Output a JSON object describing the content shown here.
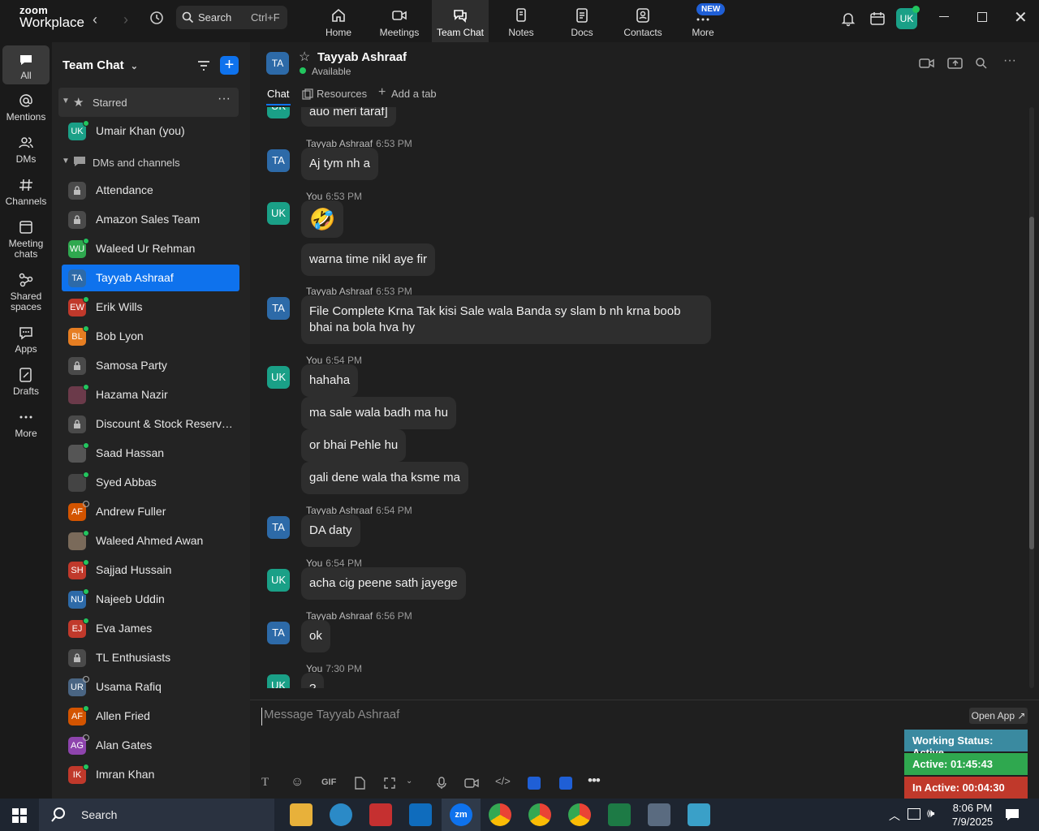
{
  "app": {
    "logo_line1": "zoom",
    "logo_line2": "Workplace"
  },
  "topbar": {
    "search_label": "Search",
    "search_shortcut": "Ctrl+F",
    "nav": [
      {
        "label": "Home"
      },
      {
        "label": "Meetings"
      },
      {
        "label": "Team Chat"
      },
      {
        "label": "Notes"
      },
      {
        "label": "Docs"
      },
      {
        "label": "Contacts"
      },
      {
        "label": "More"
      }
    ],
    "new_badge": "NEW",
    "user_initials": "UK"
  },
  "rail": [
    {
      "label": "All"
    },
    {
      "label": "Mentions"
    },
    {
      "label": "DMs"
    },
    {
      "label": "Channels"
    },
    {
      "label1": "Meeting",
      "label2": "chats"
    },
    {
      "label1": "Shared",
      "label2": "spaces"
    },
    {
      "label": "Apps"
    },
    {
      "label": "Drafts"
    },
    {
      "label": "More"
    }
  ],
  "sidebar": {
    "title": "Team Chat",
    "starred_label": "Starred",
    "dms_label": "DMs and channels",
    "self": {
      "initials": "UK",
      "name": "Umair Khan (you)"
    },
    "chats": [
      {
        "initials": "",
        "name": "Attendance"
      },
      {
        "initials": "",
        "name": "Amazon Sales Team"
      },
      {
        "initials": "WU",
        "name": "Waleed Ur Rehman"
      },
      {
        "initials": "TA",
        "name": "Tayyab Ashraaf"
      },
      {
        "initials": "EW",
        "name": "Erik Wills"
      },
      {
        "initials": "BL",
        "name": "Bob Lyon"
      },
      {
        "initials": "",
        "name": "Samosa Party"
      },
      {
        "initials": "",
        "name": "Hazama Nazir"
      },
      {
        "initials": "",
        "name": "Discount & Stock Reservati..."
      },
      {
        "initials": "",
        "name": "Saad Hassan"
      },
      {
        "initials": "",
        "name": "Syed Abbas"
      },
      {
        "initials": "AF",
        "name": "Andrew Fuller"
      },
      {
        "initials": "",
        "name": "Waleed Ahmed Awan"
      },
      {
        "initials": "SH",
        "name": "Sajjad Hussain"
      },
      {
        "initials": "NU",
        "name": "Najeeb Uddin"
      },
      {
        "initials": "EJ",
        "name": "Eva James"
      },
      {
        "initials": "",
        "name": "TL Enthusiasts"
      },
      {
        "initials": "UR",
        "name": "Usama Rafiq"
      },
      {
        "initials": "AF",
        "name": "Allen Fried"
      },
      {
        "initials": "AG",
        "name": "Alan Gates"
      },
      {
        "initials": "IK",
        "name": "Imran Khan"
      }
    ]
  },
  "main": {
    "contact_initials": "TA",
    "contact_name": "Tayyab Ashraaf",
    "contact_status": "Available",
    "tabs": {
      "chat": "Chat",
      "resources": "Resources",
      "add": "Add a tab"
    },
    "top_partial": "auo meri taraf]",
    "messages": [
      {
        "av": "TA",
        "sender": "Tayyab Ashraaf",
        "time": "6:53 PM",
        "bubbles": [
          "Aj tym nh a"
        ]
      },
      {
        "av": "UK",
        "sender": "You",
        "time": "6:53 PM",
        "bubbles": [
          "🤣",
          "warna time nikl aye fir"
        ]
      },
      {
        "av": "TA",
        "sender": "Tayyab Ashraaf",
        "time": "6:53 PM",
        "bubbles": [
          "File Complete Krna Tak kisi Sale wala Banda sy slam b nh krna boob bhai na bola hva hy"
        ]
      },
      {
        "av": "UK",
        "sender": "You",
        "time": "6:54 PM",
        "bubbles": [
          "hahaha",
          "ma sale wala badh ma hu",
          "or bhai Pehle hu",
          "gali dene wala tha ksme ma"
        ]
      },
      {
        "av": "TA",
        "sender": "Tayyab Ashraaf",
        "time": "6:54 PM",
        "bubbles": [
          "DA daty"
        ]
      },
      {
        "av": "UK",
        "sender": "You",
        "time": "6:54 PM",
        "bubbles": [
          "acha cig peene sath jayege"
        ]
      },
      {
        "av": "TA",
        "sender": "Tayyab Ashraaf",
        "time": "6:56 PM",
        "bubbles": [
          "ok"
        ]
      },
      {
        "av": "UK",
        "sender": "You",
        "time": "7:30 PM",
        "bubbles": [
          "?"
        ]
      }
    ],
    "composer_placeholder": "Message Tayyab Ashraaf",
    "open_app": "Open App ↗",
    "composer_gif": "GIF",
    "working_status": "Working Status: Active",
    "active_time": "Active: 01:45:43",
    "inactive_time": "In Active: 00:04:30"
  },
  "taskbar": {
    "search": "Search",
    "time": "8:06 PM",
    "date": "7/9/2025"
  },
  "colors": {
    "accent": "#0e72ed",
    "bg": "#1f1f1f",
    "bubble": "#2e2e2e",
    "online": "#22c55e",
    "ta_avatar": "#2d6aa8",
    "uk_avatar": "#1aa087"
  }
}
